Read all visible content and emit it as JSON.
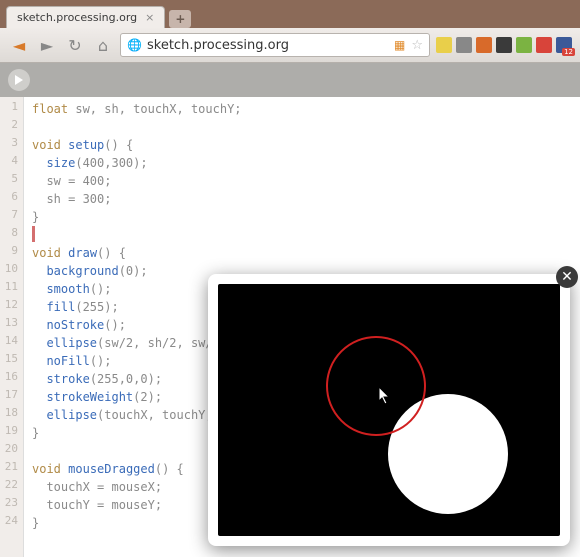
{
  "browser": {
    "tab_title": "sketch.processing.org",
    "url": "sketch.processing.org",
    "nav": {
      "back": "◄",
      "forward": "►",
      "reload": "↻",
      "home": "⌂"
    },
    "ext_colors": [
      "#e9cf4a",
      "#888888",
      "#d86a2a",
      "#3a3a3a",
      "#7bb342",
      "#d8443a",
      "#3b5998"
    ]
  },
  "editor": {
    "lines": [
      "float sw, sh, touchX, touchY;",
      "",
      "void setup() {",
      "  size(400,300);",
      "  sw = 400;",
      "  sh = 300;",
      "}",
      "",
      "void draw() {",
      "  background(0);",
      "  smooth();",
      "  fill(255);",
      "  noStroke();",
      "  ellipse(sw/2, sh/2, sw/",
      "  noFill();",
      "  stroke(255,0,0);",
      "  strokeWeight(2);",
      "  ellipse(touchX, touchY,",
      "}",
      "",
      "void mouseDragged() {",
      "  touchX = mouseX;",
      "  touchY = mouseY;",
      "}"
    ]
  },
  "preview": {
    "close_glyph": "✕"
  }
}
